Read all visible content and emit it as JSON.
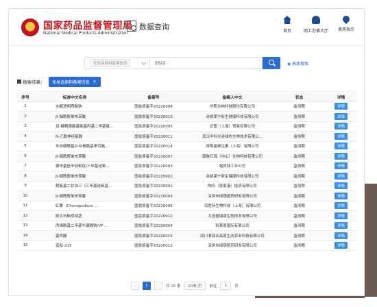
{
  "header": {
    "brand_cn": "国家药品监督管理局",
    "brand_en": "National Medical Products Administration",
    "section_title": "数据查询",
    "nav": [
      {
        "label": "首页",
        "icon": "home-icon"
      },
      {
        "label": "网上办事大厅",
        "icon": "user-icon"
      },
      {
        "label": "使用指示",
        "icon": "pin-icon"
      }
    ]
  },
  "search": {
    "category": "化妆品原料备案信息",
    "keyword": "2022",
    "advanced_label": "高级搜索"
  },
  "result": {
    "label": "搜索结果：",
    "chip": "化妆品原料备案信息"
  },
  "table": {
    "columns": [
      "序号",
      "标准中文名称",
      "备案号",
      "备案人中文",
      "状态",
      "详情"
    ],
    "detail_label": "详情",
    "rows": [
      {
        "no": "1",
        "name": "水解透明质酸钠",
        "code": "国妆原备字20220008",
        "company": "华熙生物科技股份有限公司",
        "status": "监测期"
      },
      {
        "no": "2",
        "name": "β-烟酰胺单核苷酸",
        "code": "国妆原备字20220013",
        "company": "余姚莱宁新生健康科技有限公司",
        "status": "监测期"
      },
      {
        "no": "3",
        "name": "双-糖精磺酸基氨基丙基二甲基氨...",
        "code": "国妆原备字20220005",
        "company": "迈图（上海）贸易有限公司",
        "status": "监测期"
      },
      {
        "no": "4",
        "name": "N-乙酰神经氨酸",
        "code": "国妆原备字20220011",
        "company": "武汉中科光谷绿色生物技术有限公...",
        "status": "监测期"
      },
      {
        "no": "5",
        "name": "羊羔磺酰基D-丝氨酰基苯丙氨...",
        "code": "国妆原备字20220014",
        "company": "帝斯曼维生素（上海）有限公司",
        "status": "监测期"
      },
      {
        "no": "6",
        "name": "β-烟酰胺单核苷酸",
        "code": "国妆原备字20220007",
        "company": "康胜红海（中山）生物科技有限公司",
        "status": "监测期"
      },
      {
        "no": "7",
        "name": "聚甲基倍半硅氧烷/三甲基硅氧...",
        "code": "国妆原备字20220003",
        "company": "格其特工业公司",
        "status": "监测期"
      },
      {
        "no": "8",
        "name": "β-烟酰胺单核苷酸",
        "code": "国妆原备字20220002",
        "company": "余姚莱宁新生健康科技有限公司",
        "status": "监测期"
      },
      {
        "no": "9",
        "name": "赖氨基二甘油三（三甲基硅氧基...",
        "code": "国妆原备字20220001",
        "company": "陶氏（张家港）投资有限公司",
        "status": "监测期"
      },
      {
        "no": "10",
        "name": "β-烟酰胺单核苷酸",
        "code": "国妆原备字20220009",
        "company": "深圳市绿荫医药研发有限公司",
        "status": "监测期"
      },
      {
        "no": "11",
        "name": "红藜（Chenopodium ...",
        "code": "国妆原备字20220006",
        "company": "百胜特生物科技（上海）有限公司",
        "status": "监测期"
      },
      {
        "no": "12",
        "name": "肤炎石斛原球茎",
        "code": "国妆原备字20220010",
        "company": "大连普瑞康生物技术有限公司",
        "status": "监测期"
      },
      {
        "no": "13",
        "name": "丙烯酰基二甲基牛磺酸钠/VP ...",
        "code": "国妆原备字20220004",
        "company": "科莱恩国际有限公司",
        "status": "监测期"
      },
      {
        "no": "14",
        "name": "蛋壳酸",
        "code": "国妆原备字20220015",
        "company": "四川滴润丘高原生态农业科技有限公司",
        "status": "监测期"
      },
      {
        "no": "15",
        "name": "富肽-215",
        "code": "国妆原备字20220012",
        "company": "深圳市绿荫医药研发有限公司",
        "status": "监测期"
      }
    ]
  },
  "pager": {
    "prev": "‹",
    "current": "1",
    "next": "›",
    "total": "共 15 条",
    "size": "20条/页",
    "goto_prefix": "前往",
    "goto_value": "1",
    "goto_suffix": "页"
  }
}
